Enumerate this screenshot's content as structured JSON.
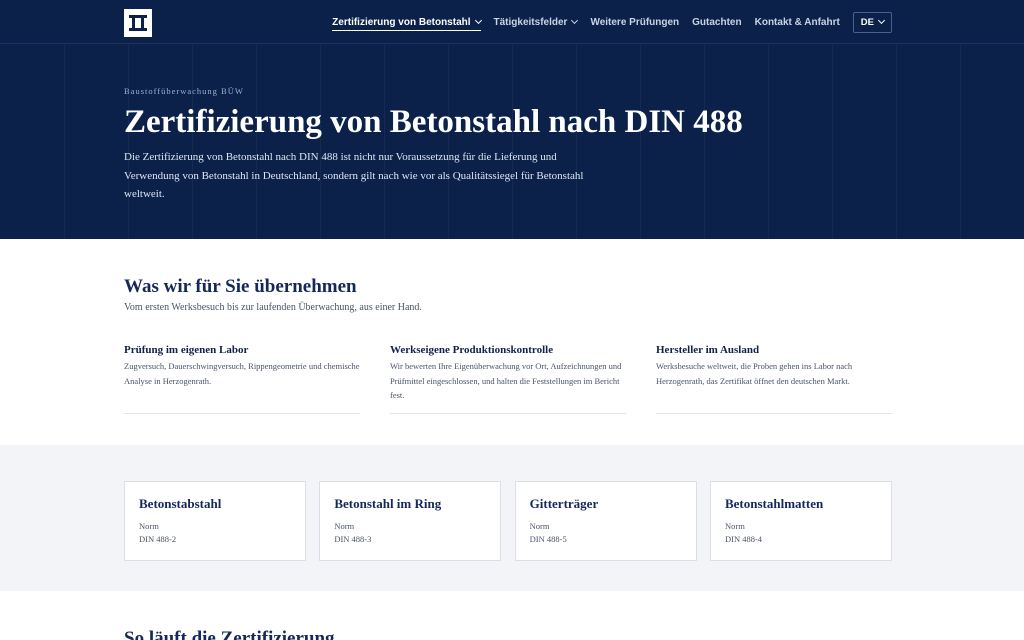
{
  "nav": {
    "items": [
      {
        "label": "Zertifizierung von Betonstahl",
        "active": true,
        "dropdown": true
      },
      {
        "label": "Tätigkeitsfelder",
        "active": false,
        "dropdown": true
      },
      {
        "label": "Weitere Prüfungen",
        "active": false,
        "dropdown": false
      },
      {
        "label": "Gutachten",
        "active": false,
        "dropdown": false
      },
      {
        "label": "Kontakt & Anfahrt",
        "active": false,
        "dropdown": false
      }
    ],
    "language": "DE"
  },
  "hero": {
    "eyebrow": "Baustoffüberwachung BÜW",
    "title": "Zertifizierung von Betonstahl nach DIN 488",
    "text": "Die Zertifizierung von Betonstahl nach DIN 488 ist nicht nur Voraussetzung für die Lieferung und Verwendung von Betonstahl in Deutschland, sondern gilt nach wie vor als Qualitätssiegel für Betonstahl weltweit."
  },
  "services": {
    "title": "Was wir für Sie übernehmen",
    "subtitle": "Vom ersten Werksbesuch bis zur laufenden Überwachung, aus einer Hand.",
    "items": [
      {
        "title": "Prüfung im eigenen Labor",
        "text": "Zugversuch, Dauerschwingversuch, Rippengeometrie und chemische Analyse in Herzogenrath."
      },
      {
        "title": "Werkseigene Produktionskontrolle",
        "text": "Wir bewerten Ihre Eigenüberwachung vor Ort, Aufzeichnungen und Prüfmittel eingeschlossen, und halten die Feststellungen im Bericht fest."
      },
      {
        "title": "Hersteller im Ausland",
        "text": "Werksbesuche weltweit, die Proben gehen ins Labor nach Herzogenrath, das Zertifikat öffnet den deutschen Markt."
      }
    ]
  },
  "products": [
    {
      "title": "Betonstabstahl",
      "label": "Norm",
      "norm": "DIN 488-2"
    },
    {
      "title": "Betonstahl im Ring",
      "label": "Norm",
      "norm": "DIN 488-3"
    },
    {
      "title": "Gitterträger",
      "label": "Norm",
      "norm": "DIN 488-5"
    },
    {
      "title": "Betonstahlmatten",
      "label": "Norm",
      "norm": "DIN 488-4"
    }
  ],
  "process": {
    "title": "So läuft die Zertifizierung"
  },
  "colors": {
    "navy": "#0b2149",
    "heading": "#14285a",
    "panel": "#f3f4f7"
  },
  "icons": {
    "logo": "steel-frame-logo-icon",
    "dropdown": "chevron-down-icon"
  }
}
